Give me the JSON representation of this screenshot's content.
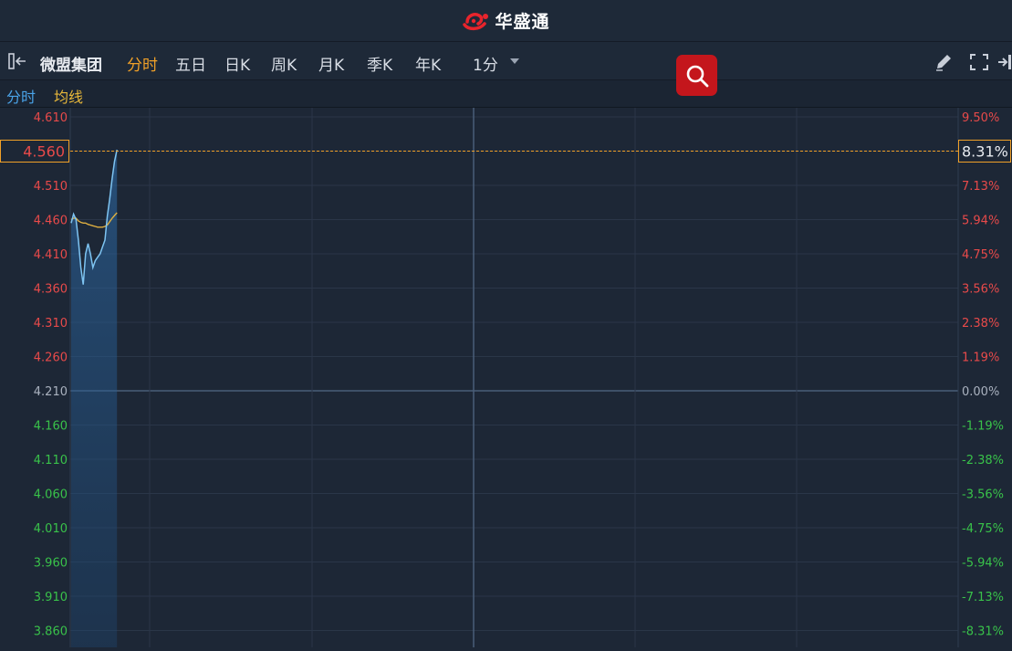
{
  "app": {
    "brand_name": "华盛通",
    "brand_color": "#e8242c"
  },
  "toolbar": {
    "stock_name": "微盟集团",
    "tabs": [
      {
        "label": "分时",
        "active": true
      },
      {
        "label": "五日",
        "active": false
      },
      {
        "label": "日K",
        "active": false
      },
      {
        "label": "周K",
        "active": false
      },
      {
        "label": "月K",
        "active": false
      },
      {
        "label": "季K",
        "active": false
      },
      {
        "label": "年K",
        "active": false
      }
    ],
    "interval": "1分",
    "icons": [
      "collapse-left-icon",
      "pencil-icon",
      "fullscreen-icon",
      "exit-icon",
      "search-icon"
    ]
  },
  "legend": {
    "items": [
      {
        "label": "分时",
        "color": "#4aa3e8"
      },
      {
        "label": "均线",
        "color": "#e8b83a"
      }
    ]
  },
  "colors": {
    "up": "#e84a4a",
    "down": "#39c24a",
    "neutral": "#aab2bf",
    "price_line": "#7ec4f2",
    "avg_line": "#e0b040",
    "cursor": "#f0a028"
  },
  "chart_data": {
    "type": "line",
    "prev_close": 4.21,
    "ylim": [
      3.86,
      4.61
    ],
    "y_ticks_price": [
      "4.610",
      "4.560",
      "4.510",
      "4.460",
      "4.410",
      "4.360",
      "4.310",
      "4.260",
      "4.210",
      "4.160",
      "4.110",
      "4.060",
      "4.010",
      "3.960",
      "3.910",
      "3.860"
    ],
    "y_ticks_pct": [
      "9.50%",
      "8.31%",
      "7.13%",
      "5.94%",
      "4.75%",
      "3.56%",
      "2.38%",
      "1.19%",
      "0.00%",
      "-1.19%",
      "-2.38%",
      "-3.56%",
      "-4.75%",
      "-5.94%",
      "-7.13%",
      "-8.31%"
    ],
    "cursor": {
      "price": "4.560",
      "pct": "8.31%"
    },
    "grid": true,
    "series": [
      {
        "name": "分时",
        "x": [
          0,
          1,
          2,
          3,
          4,
          5,
          6,
          7,
          8,
          9,
          10,
          11,
          12,
          13,
          14,
          15,
          16,
          17,
          18,
          19
        ],
        "values": [
          4.455,
          4.468,
          4.46,
          4.43,
          4.39,
          4.365,
          4.41,
          4.425,
          4.41,
          4.39,
          4.4,
          4.405,
          4.41,
          4.42,
          4.43,
          4.465,
          4.49,
          4.52,
          4.545,
          4.562
        ]
      },
      {
        "name": "均线",
        "x": [
          0,
          1,
          2,
          3,
          4,
          5,
          6,
          7,
          8,
          9,
          10,
          11,
          12,
          13,
          14,
          15,
          16,
          17,
          18,
          19
        ],
        "values": [
          4.46,
          4.462,
          4.462,
          4.458,
          4.456,
          4.455,
          4.455,
          4.453,
          4.452,
          4.451,
          4.45,
          4.449,
          4.449,
          4.449,
          4.45,
          4.452,
          4.457,
          4.462,
          4.466,
          4.47
        ]
      }
    ]
  }
}
